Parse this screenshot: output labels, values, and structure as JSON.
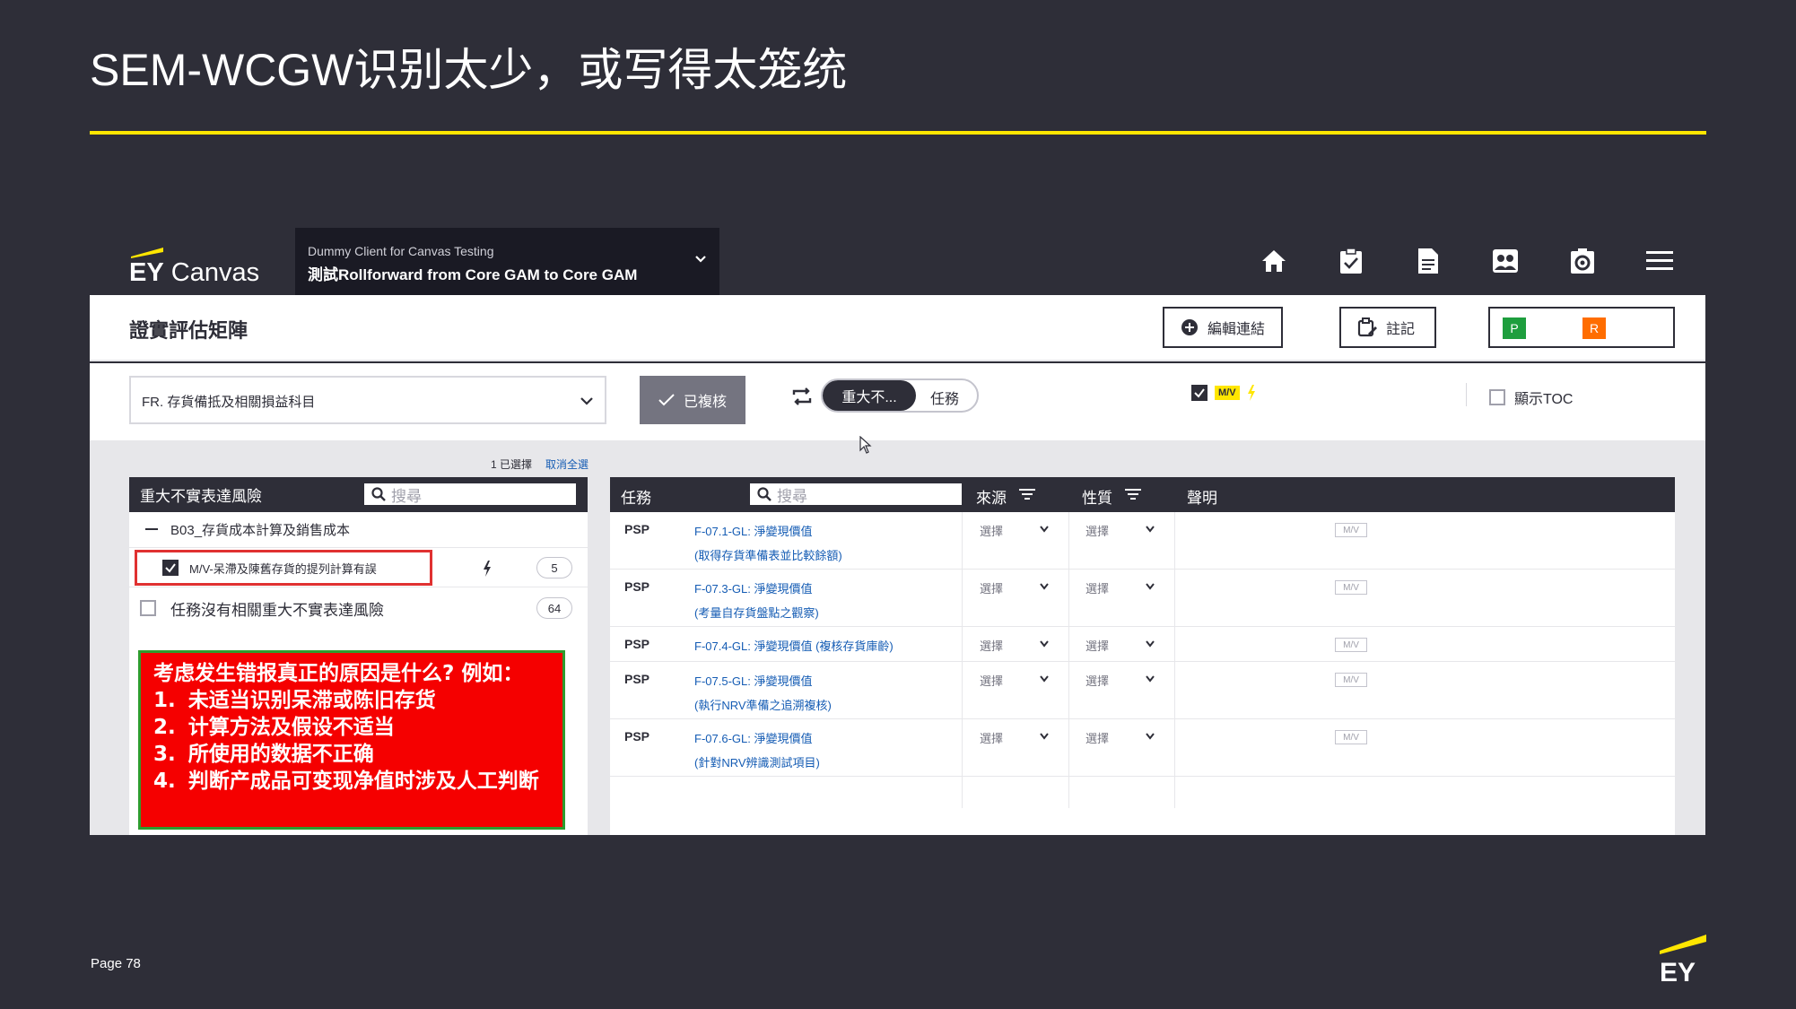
{
  "slide": {
    "title": "SEM-WCGW识别太少，或写得太笼统",
    "page_label": "Page 78",
    "accent_color": "#ffe600",
    "background_color": "#2e2e38"
  },
  "app": {
    "brand_ey": "EY",
    "brand_name": "Canvas",
    "client_small": "Dummy Client for Canvas Testing",
    "client_main": "測試Rollforward from Core GAM to Core GAM",
    "nav_icons": [
      "home-icon",
      "clipboard-check-icon",
      "document-icon",
      "people-icon",
      "settings-gear-icon",
      "hamburger-menu-icon"
    ]
  },
  "page": {
    "heading": "證實評估矩陣",
    "edit_links_label": "編輯連結",
    "notes_label": "註記",
    "p_badge": "P",
    "r_badge": "R",
    "p_color": "#1e9e3e",
    "r_color": "#ff6d00"
  },
  "filters": {
    "account_dropdown": "FR. 存貨備抵及相關損益科目",
    "reviewed_label": "已複核",
    "toggle_on": "重大不...",
    "toggle_off": "任務",
    "mv_tag": "M/V",
    "show_toc_label": "顯示TOC",
    "selected_count": "1 已選擇",
    "deselect_all": "取消全選"
  },
  "left_panel": {
    "header": "重大不實表達風險",
    "search_placeholder": "搜尋",
    "group": "B03_存貨成本計算及銷售成本",
    "risk_label": "M/V-呆滯及陳舊存貨的提列計算有誤",
    "risk_count": "5",
    "no_risk_label": "任務沒有相關重大不實表達風險",
    "no_risk_count": "64"
  },
  "callout": {
    "heading": "考虑发生错报真正的原因是什么? 例如：",
    "items": [
      {
        "num": "1.",
        "text": "未适当识别呆滞或陈旧存货"
      },
      {
        "num": "2.",
        "text": "计算方法及假设不适当"
      },
      {
        "num": "3.",
        "text": "所使用的数据不正确"
      },
      {
        "num": "4.",
        "text": "判断产成品可变现净值时涉及人工判断"
      }
    ]
  },
  "right_panel": {
    "col_task": "任務",
    "search_placeholder": "搜尋",
    "col_source": "來源",
    "col_nature": "性質",
    "col_assertion": "聲明",
    "select_placeholder": "選擇",
    "mv_label": "M/V",
    "rows": [
      {
        "type": "PSP",
        "title": "F-07.1-GL: 淨變現價值",
        "sub": "(取得存貨準備表並比較餘額)"
      },
      {
        "type": "PSP",
        "title": "F-07.3-GL: 淨變現價值",
        "sub": "(考量自存貨盤點之觀察)"
      },
      {
        "type": "PSP",
        "title": "F-07.4-GL: 淨變現價值 (複核存貨庫齡)",
        "sub": ""
      },
      {
        "type": "PSP",
        "title": "F-07.5-GL: 淨變現價值",
        "sub": "(執行NRV準備之追溯複核)"
      },
      {
        "type": "PSP",
        "title": "F-07.6-GL: 淨變現價值",
        "sub": "(針對NRV辨識測試項目)"
      }
    ]
  }
}
